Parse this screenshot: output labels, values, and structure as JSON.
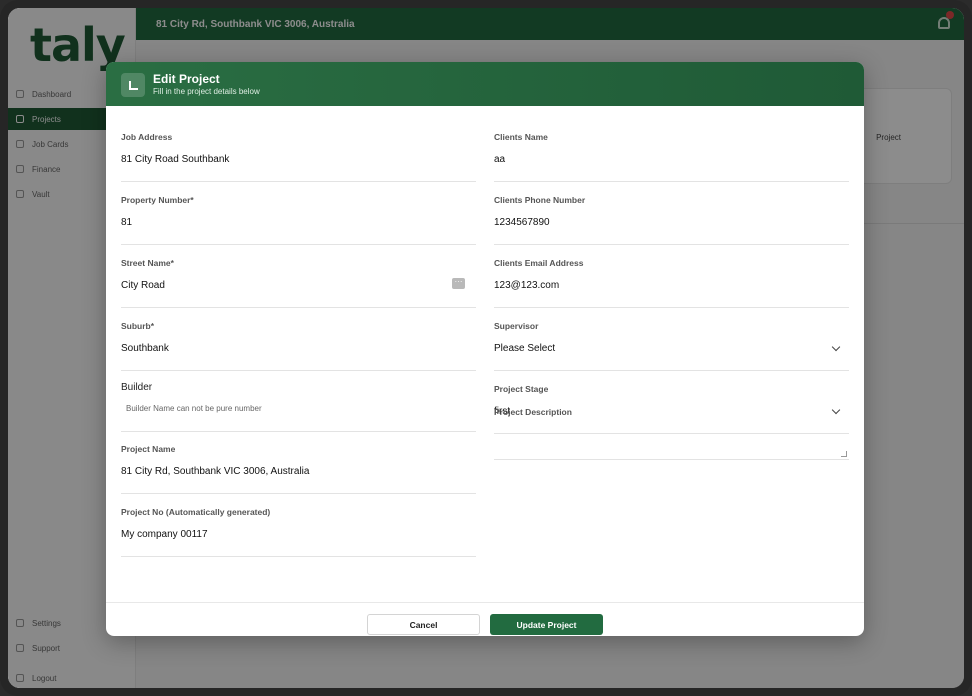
{
  "app": {
    "logo": "taly",
    "location": "81 City Rd, Southbank VIC 3006, Australia",
    "nav": [
      "Dashboard",
      "Projects",
      "Job Cards",
      "Finance",
      "Vault"
    ],
    "nav_bottom": [
      "Settings",
      "Support",
      "Logout"
    ],
    "bg_card_label": "Project"
  },
  "modal": {
    "title": "Edit Project",
    "subtitle": "Fill in the project details below",
    "fields": {
      "job_address": {
        "label": "Job Address",
        "value": "81 City Road Southbank"
      },
      "clients_name": {
        "label": "Clients Name",
        "value": "aa"
      },
      "property_number": {
        "label": "Property Number*",
        "value": "81"
      },
      "clients_phone": {
        "label": "Clients Phone Number",
        "value": "1234567890"
      },
      "street_name": {
        "label": "Street Name*",
        "value": "City Road"
      },
      "clients_email": {
        "label": "Clients Email Address",
        "value": "123@123.com"
      },
      "suburb": {
        "label": "Suburb*",
        "value": "Southbank"
      },
      "supervisor": {
        "label": "Supervisor",
        "value": "Please Select"
      },
      "builder": {
        "label": "Builder",
        "placeholder": "Builder Name can not be pure number"
      },
      "project_stage": {
        "label": "Project Stage",
        "value": "first"
      },
      "project_name": {
        "label": "Project Name",
        "value": "81 City Rd, Southbank VIC 3006, Australia"
      },
      "project_description": {
        "label": "Project Description",
        "value": ""
      },
      "project_no": {
        "label": "Project No (Automatically generated)",
        "value": "My company 00117"
      }
    },
    "cancel_label": "Cancel",
    "update_label": "Update Project"
  }
}
